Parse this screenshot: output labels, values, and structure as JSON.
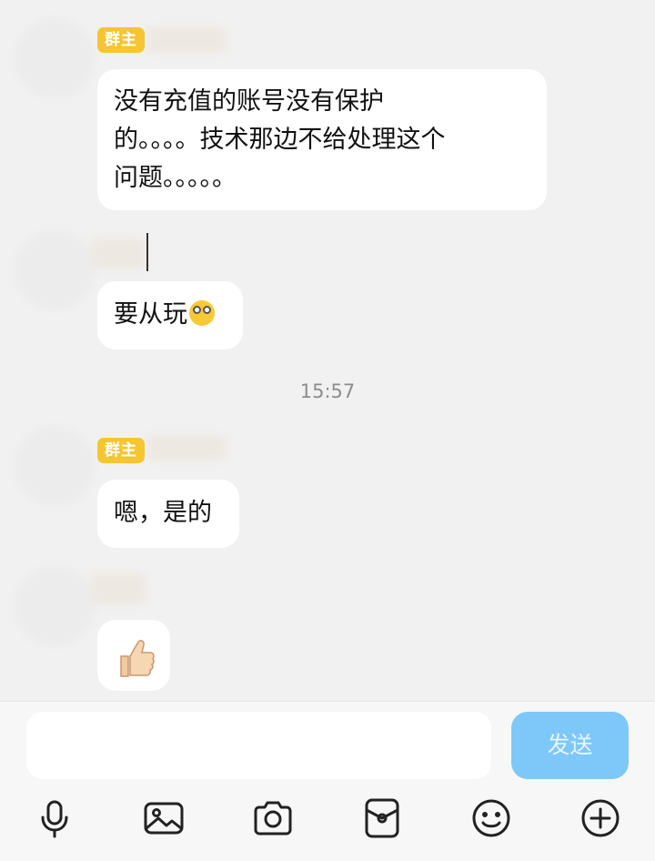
{
  "messages": [
    {
      "badge": "群主",
      "lines": [
        "没有充值的账号没有保护",
        "的。。。。技术那边不给处理这个",
        "问题。。。。。"
      ]
    },
    {
      "text": "要从玩",
      "emoji": "shocked-face"
    },
    {
      "badge": "群主",
      "text": "嗯，是的"
    },
    {
      "emoji": "thumbs-up"
    }
  ],
  "timestamp": "15:57",
  "composer": {
    "placeholder": "",
    "send_label": "发送"
  },
  "toolbar": [
    "microphone-icon",
    "image-icon",
    "camera-icon",
    "red-packet-icon",
    "emoji-icon",
    "plus-icon"
  ],
  "colors": {
    "badge": "#f7c531",
    "send": "#7ec7f9",
    "background": "#f1f1f1"
  }
}
